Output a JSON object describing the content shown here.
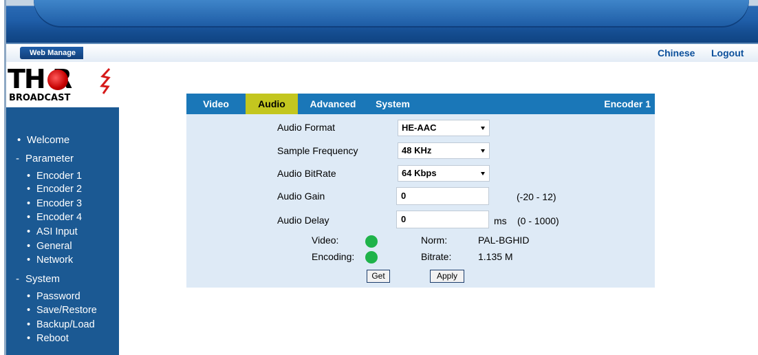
{
  "header": {
    "web_manage_label": "Web Manage",
    "links": [
      "Chinese",
      "Logout"
    ]
  },
  "logo": {
    "thor_text": "TH R",
    "sub_text": "BROADCAST"
  },
  "sidebar": {
    "welcome": "Welcome",
    "parameter": "Parameter",
    "parameter_items": [
      "Encoder 1",
      "Encoder 2",
      "Encoder 3",
      "Encoder 4",
      "ASI Input",
      "General",
      "Network"
    ],
    "system": "System",
    "system_items": [
      "Password",
      "Save/Restore",
      "Backup/Load",
      "Reboot"
    ]
  },
  "tabs": {
    "items": [
      "Video",
      "Audio",
      "Advanced",
      "System"
    ],
    "active": "Audio",
    "encoder_title": "Encoder 1"
  },
  "form": {
    "audio_format_label": "Audio Format",
    "audio_format_value": "HE-AAC",
    "sample_frequency_label": "Sample Frequency",
    "sample_frequency_value": "48 KHz",
    "audio_bitrate_label": "Audio BitRate",
    "audio_bitrate_value": "64 Kbps",
    "audio_gain_label": "Audio Gain",
    "audio_gain_value": "0",
    "audio_gain_range": "(-20 - 12)",
    "audio_delay_label": "Audio Delay",
    "audio_delay_value": "0",
    "audio_delay_unit": "ms",
    "audio_delay_range": "(0 - 1000)"
  },
  "status": {
    "video_label": "Video:",
    "encoding_label": "Encoding:",
    "norm_label": "Norm:",
    "norm_value": "PAL-BGHID",
    "bitrate_label": "Bitrate:",
    "bitrate_value": "1.135 M",
    "indicator_color": "#1fb34a"
  },
  "buttons": {
    "get": "Get",
    "apply": "Apply"
  },
  "colors": {
    "sidebar_bg": "#1b5993",
    "tabbar_bg": "#1a77b8",
    "active_tab_bg": "#c3c61f",
    "panel_bg": "#deeaf6",
    "link_color": "#0b4f9b"
  }
}
